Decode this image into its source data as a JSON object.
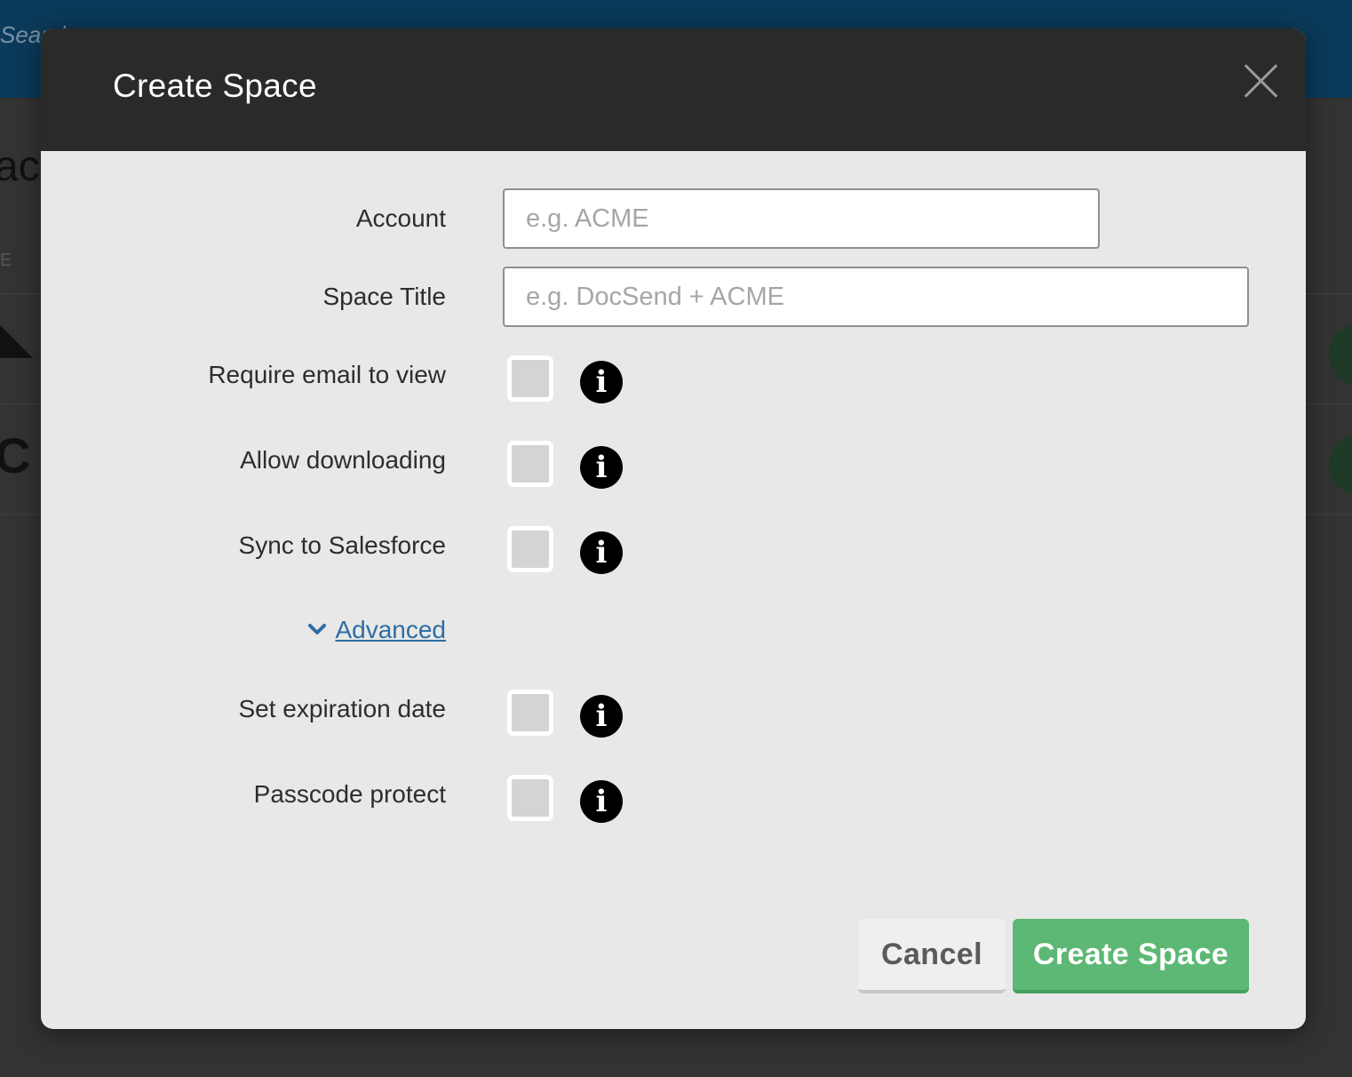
{
  "background": {
    "search_hint": "Search",
    "page_title_fragment": "ac",
    "column_header_fragment": "E",
    "row1_glyph": "◣",
    "row2_glyph": "C"
  },
  "modal": {
    "title": "Create Space",
    "close_icon": "close-icon",
    "fields": {
      "account": {
        "label": "Account",
        "placeholder": "e.g. ACME",
        "value": ""
      },
      "space_title": {
        "label": "Space Title",
        "placeholder": "e.g. DocSend + ACME",
        "value": ""
      }
    },
    "options": [
      {
        "label": "Require email to view",
        "checked": false,
        "icon": "info-icon"
      },
      {
        "label": "Allow downloading",
        "checked": false,
        "icon": "info-icon"
      },
      {
        "label": "Sync to Salesforce",
        "checked": false,
        "icon": "info-icon"
      }
    ],
    "advanced": {
      "label": "Advanced",
      "icon": "chevron-down-icon",
      "expanded": true
    },
    "advanced_options": [
      {
        "label": "Set expiration date",
        "checked": false,
        "icon": "info-icon"
      },
      {
        "label": "Passcode protect",
        "checked": false,
        "icon": "info-icon"
      }
    ],
    "info_glyph": "i",
    "buttons": {
      "cancel": "Cancel",
      "create": "Create Space"
    }
  },
  "colors": {
    "header_bg": "#2a2a2a",
    "body_bg": "#e8e8e8",
    "primary": "#5cb874",
    "link": "#2e6da4"
  }
}
